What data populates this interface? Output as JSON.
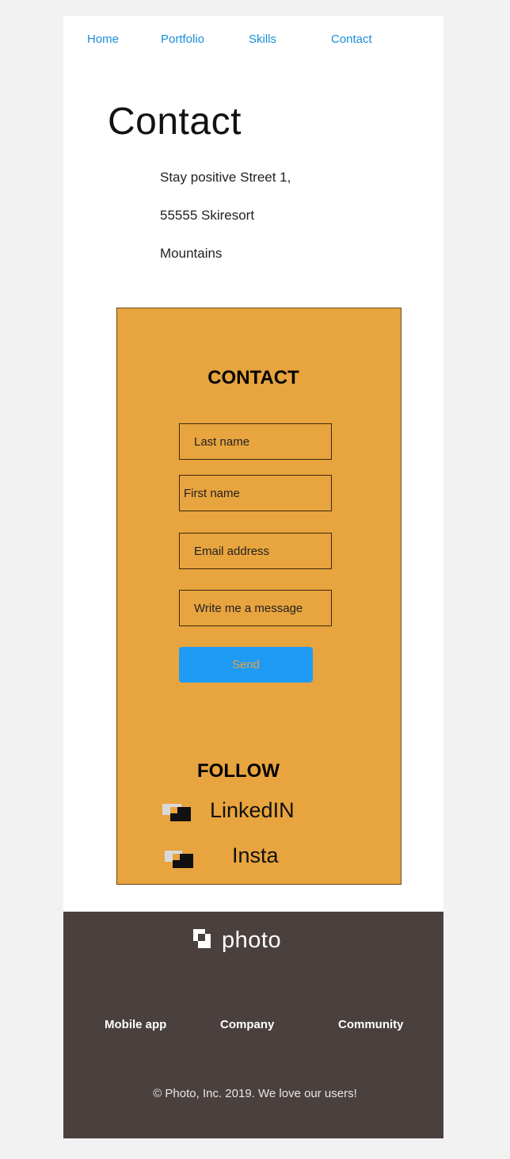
{
  "nav": {
    "items": [
      {
        "label": "Home"
      },
      {
        "label": "Portfolio"
      },
      {
        "label": "Skills"
      },
      {
        "label": "Contact"
      }
    ]
  },
  "page_title": "Contact",
  "address": {
    "line1": "Stay positive Street 1,",
    "line2": "55555 Skiresort",
    "line3": "Mountains"
  },
  "form": {
    "heading": "CONTACT",
    "last_name_placeholder": "Last name",
    "first_name_placeholder": "First name",
    "email_placeholder": "Email address",
    "message_placeholder": "Write me a message",
    "send_label": "Send"
  },
  "follow": {
    "heading": "FOLLOW",
    "linkedin_label": "LinkedIN",
    "insta_label": "Insta"
  },
  "footer": {
    "brand": "photo",
    "links": [
      {
        "label": "Mobile app"
      },
      {
        "label": "Company"
      },
      {
        "label": "Community"
      }
    ],
    "copyright": "© Photo, Inc. 2019. We love our users!"
  },
  "colors": {
    "accent_orange": "#e8a43e",
    "button_blue": "#1e9bf5",
    "nav_link_blue": "#1a8fd9",
    "footer_bg": "#4a413f",
    "page_bg": "#f2f2f2"
  },
  "icons": {
    "social_icon": "photo-logo-icon",
    "brand_icon": "photo-logo-icon"
  }
}
